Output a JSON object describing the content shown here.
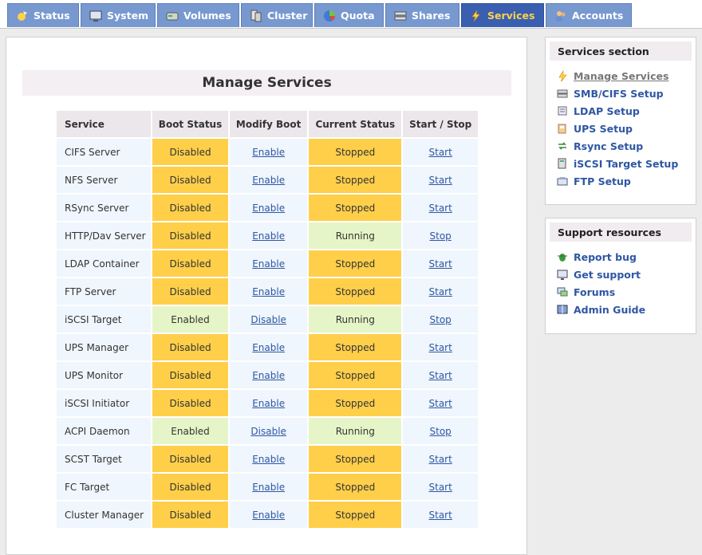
{
  "tabs": [
    {
      "label": "Status",
      "icon": "status-icon"
    },
    {
      "label": "System",
      "icon": "system-icon"
    },
    {
      "label": "Volumes",
      "icon": "volumes-icon"
    },
    {
      "label": "Cluster",
      "icon": "cluster-icon"
    },
    {
      "label": "Quota",
      "icon": "quota-icon"
    },
    {
      "label": "Shares",
      "icon": "shares-icon"
    },
    {
      "label": "Services",
      "icon": "lightning-icon",
      "active": true
    },
    {
      "label": "Accounts",
      "icon": "accounts-icon"
    }
  ],
  "main": {
    "title": "Manage Services",
    "columns": [
      "Service",
      "Boot Status",
      "Modify Boot",
      "Current Status",
      "Start / Stop"
    ],
    "rows": [
      {
        "service": "CIFS Server",
        "boot": "Disabled",
        "modify": "Enable",
        "current": "Stopped",
        "action": "Start"
      },
      {
        "service": "NFS Server",
        "boot": "Disabled",
        "modify": "Enable",
        "current": "Stopped",
        "action": "Start"
      },
      {
        "service": "RSync Server",
        "boot": "Disabled",
        "modify": "Enable",
        "current": "Stopped",
        "action": "Start"
      },
      {
        "service": "HTTP/Dav Server",
        "boot": "Disabled",
        "modify": "Enable",
        "current": "Running",
        "action": "Stop"
      },
      {
        "service": "LDAP Container",
        "boot": "Disabled",
        "modify": "Enable",
        "current": "Stopped",
        "action": "Start"
      },
      {
        "service": "FTP Server",
        "boot": "Disabled",
        "modify": "Enable",
        "current": "Stopped",
        "action": "Start"
      },
      {
        "service": "iSCSI Target",
        "boot": "Enabled",
        "modify": "Disable",
        "current": "Running",
        "action": "Stop"
      },
      {
        "service": "UPS Manager",
        "boot": "Disabled",
        "modify": "Enable",
        "current": "Stopped",
        "action": "Start"
      },
      {
        "service": "UPS Monitor",
        "boot": "Disabled",
        "modify": "Enable",
        "current": "Stopped",
        "action": "Start"
      },
      {
        "service": "iSCSI Initiator",
        "boot": "Disabled",
        "modify": "Enable",
        "current": "Stopped",
        "action": "Start"
      },
      {
        "service": "ACPI Daemon",
        "boot": "Enabled",
        "modify": "Disable",
        "current": "Running",
        "action": "Stop"
      },
      {
        "service": "SCST Target",
        "boot": "Disabled",
        "modify": "Enable",
        "current": "Stopped",
        "action": "Start"
      },
      {
        "service": "FC Target",
        "boot": "Disabled",
        "modify": "Enable",
        "current": "Stopped",
        "action": "Start"
      },
      {
        "service": "Cluster Manager",
        "boot": "Disabled",
        "modify": "Enable",
        "current": "Stopped",
        "action": "Start"
      }
    ]
  },
  "services_section": {
    "title": "Services section",
    "items": [
      {
        "label": "Manage Services",
        "icon": "manage-services-icon",
        "current": true
      },
      {
        "label": "SMB/CIFS Setup",
        "icon": "smb-cifs-icon"
      },
      {
        "label": "LDAP Setup",
        "icon": "ldap-icon"
      },
      {
        "label": "UPS Setup",
        "icon": "ups-icon"
      },
      {
        "label": "Rsync Setup",
        "icon": "rsync-icon"
      },
      {
        "label": "iSCSI Target Setup",
        "icon": "iscsi-icon"
      },
      {
        "label": "FTP Setup",
        "icon": "ftp-icon"
      }
    ]
  },
  "support_resources": {
    "title": "Support resources",
    "items": [
      {
        "label": "Report bug",
        "icon": "bug-icon"
      },
      {
        "label": "Get support",
        "icon": "support-icon"
      },
      {
        "label": "Forums",
        "icon": "forums-icon"
      },
      {
        "label": "Admin Guide",
        "icon": "book-icon"
      }
    ]
  },
  "colors": {
    "tab": "#7899cf",
    "tab_active": "#3a5fb1",
    "tab_active_text": "#ffd24a",
    "status_bad": "#ffcf4a",
    "status_good": "#e6f5c7",
    "link": "#2e57a3"
  }
}
